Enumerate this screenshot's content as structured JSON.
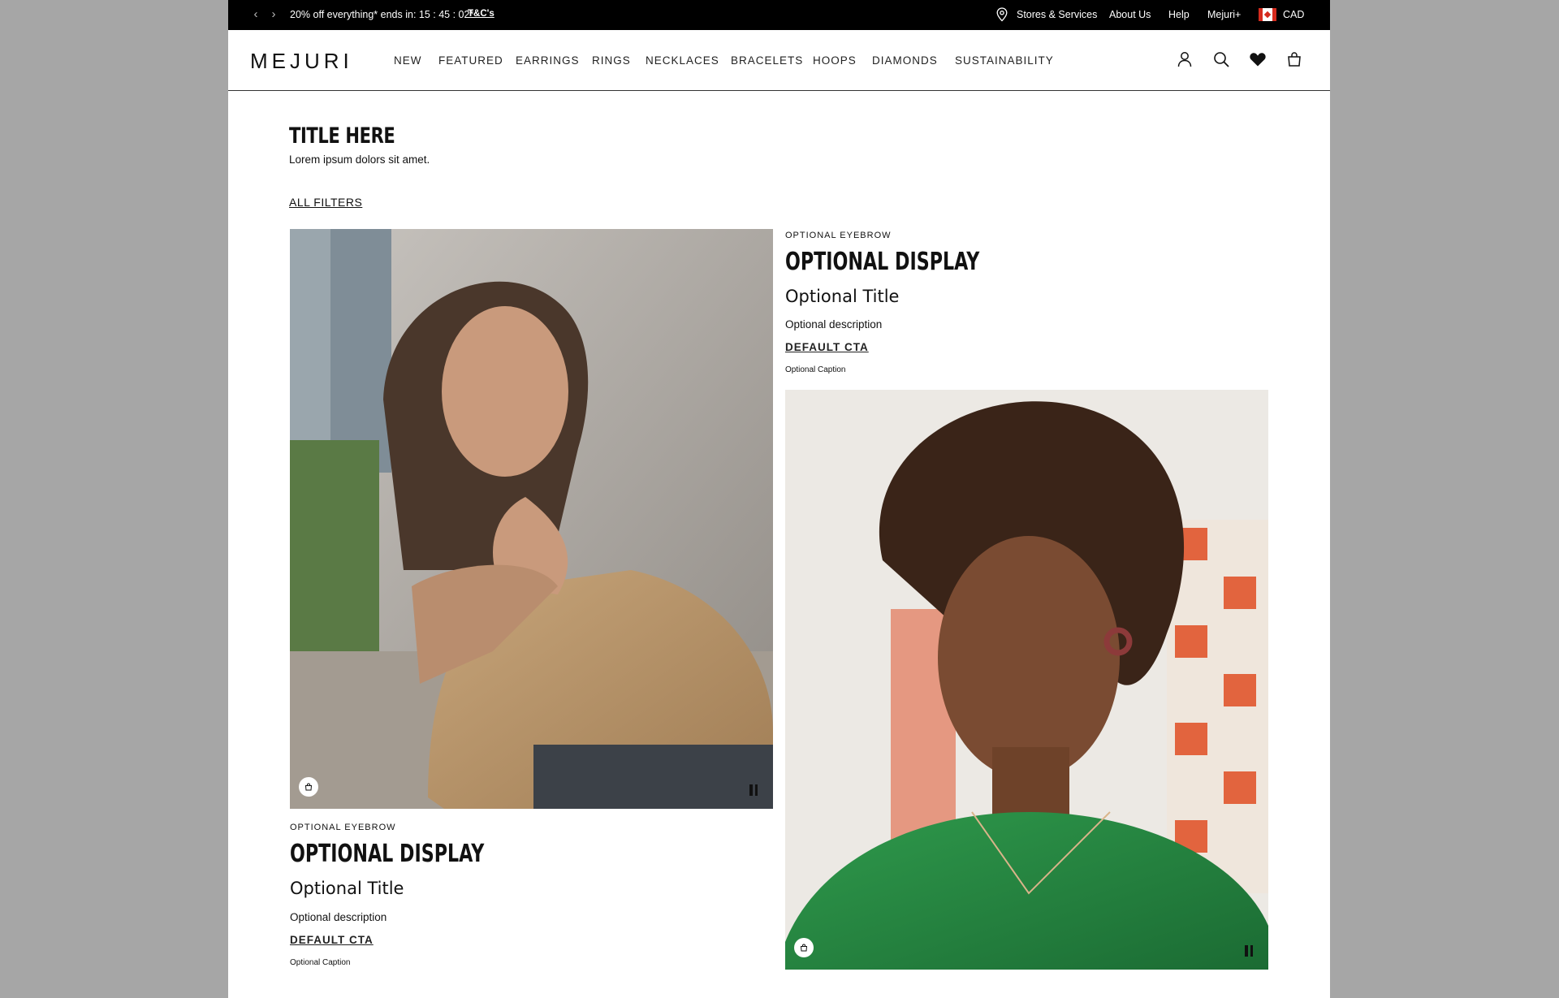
{
  "announcement": {
    "prev_arrow": "‹",
    "next_arrow": "›",
    "promo_text": "20% off everything* ends in: 15 : 45 : 02*",
    "terms_link": "T&C's",
    "utility_links": [
      "Stores & Services",
      "About Us",
      "Help",
      "Mejuri+"
    ],
    "currency": "CAD",
    "location_icon": "map-pin-icon",
    "flag_icon": "canada-flag-icon"
  },
  "header": {
    "logo": "MEJURI",
    "nav": [
      "NEW",
      "FEATURED",
      "EARRINGS",
      "RINGS",
      "NECKLACES",
      "BRACELETS",
      "HOOPS",
      "DIAMONDS",
      "SUSTAINABILITY"
    ],
    "icons": [
      "account-icon",
      "search-icon",
      "wishlist-heart-icon",
      "shopping-bag-icon"
    ]
  },
  "content": {
    "title": "TITLE HERE",
    "subtitle": "Lorem ipsum dolors sit amet.",
    "filters_label": "ALL FILTERS"
  },
  "cards": [
    {
      "image": "Woman in tan striped shirt smiling, wearing silver rings and necklace",
      "eyebrow": "OPTIONAL EYEBROW",
      "display": "OPTIONAL DISPLAY",
      "title": "Optional Title",
      "description": "Optional description",
      "cta": "DEFAULT CTA",
      "caption": "Optional Caption"
    },
    {
      "image": "Woman with curly hair in green top wearing gold hoop earrings and necklace",
      "eyebrow": "OPTIONAL EYEBROW",
      "display": "OPTIONAL DISPLAY",
      "title": "Optional Title",
      "description": "Optional description",
      "cta": "DEFAULT CTA",
      "caption": "Optional Caption"
    }
  ],
  "colors": {
    "topbar_bg": "#000000",
    "page_bg": "#ffffff",
    "outer_bg": "#a6a6a6"
  }
}
